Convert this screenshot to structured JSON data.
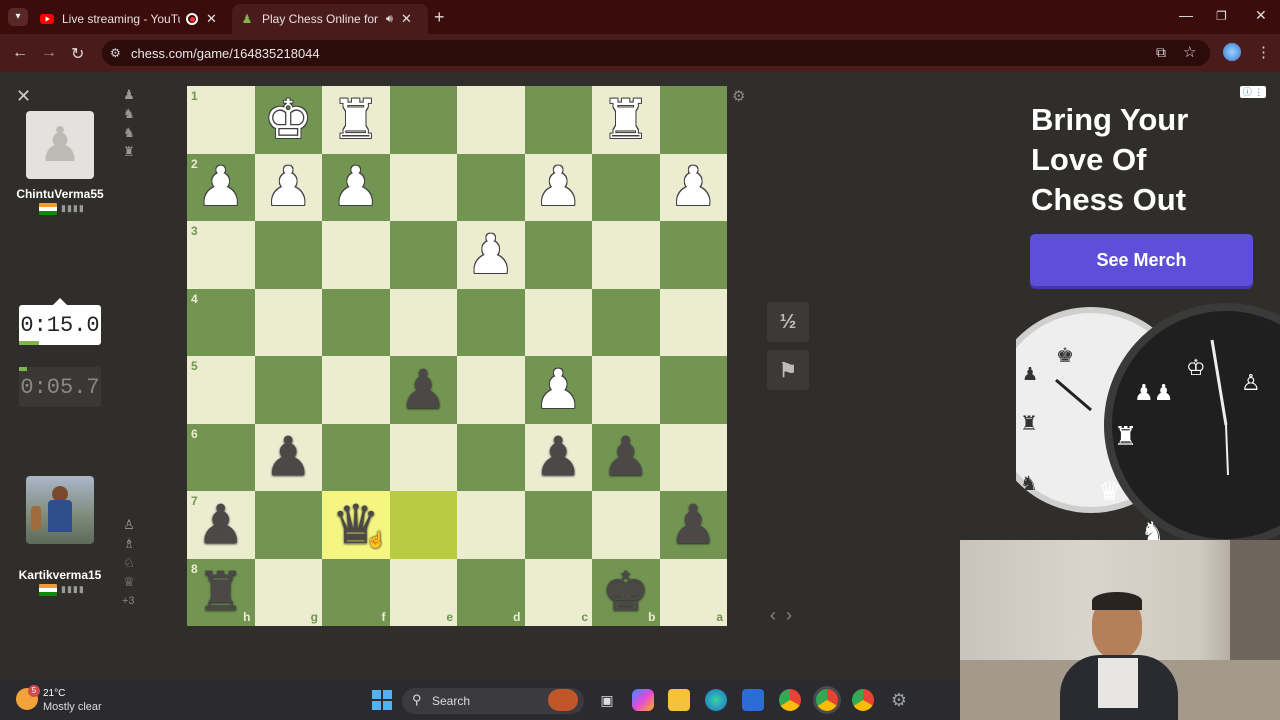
{
  "browser": {
    "tabs": [
      {
        "title": "Live streaming - YouTube Stu",
        "icon": "youtube-icon",
        "color": "#ff0000"
      },
      {
        "title": "Play Chess Online for FREE",
        "icon": "chess-pawn-icon",
        "color": "#81b64c"
      }
    ],
    "url": "chess.com/game/164835218044"
  },
  "players": {
    "top": {
      "name": "ChintuVerma55",
      "clock": "0:15.0",
      "clock_active": true
    },
    "bottom": {
      "name": "Kartikverma15",
      "clock": "0:05.7",
      "clock_active": false,
      "material": "+3"
    }
  },
  "board": {
    "orientation": "black",
    "ranks": [
      "1",
      "2",
      "3",
      "4",
      "5",
      "6",
      "7",
      "8"
    ],
    "files": [
      "h",
      "g",
      "f",
      "e",
      "d",
      "c",
      "b",
      "a"
    ],
    "rows": [
      [
        "",
        "wK",
        "wR",
        "",
        "",
        "",
        "wR",
        ""
      ],
      [
        "wP",
        "wP",
        "wP",
        "",
        "",
        "wP",
        "",
        "wP"
      ],
      [
        "",
        "",
        "",
        "",
        "wP",
        "",
        "",
        ""
      ],
      [
        "",
        "",
        "",
        "",
        "",
        "",
        "",
        ""
      ],
      [
        "",
        "",
        "",
        "bP",
        "",
        "wP",
        "",
        ""
      ],
      [
        "",
        "bP",
        "",
        "",
        "",
        "bP",
        "bP",
        ""
      ],
      [
        "bP",
        "",
        "bQ",
        "",
        "",
        "",
        "",
        "bP"
      ],
      [
        "bR",
        "",
        "",
        "",
        "",
        "",
        "bK",
        ""
      ]
    ],
    "highlights": [
      [
        6,
        2
      ],
      [
        6,
        3
      ]
    ]
  },
  "controls": {
    "draw_label": "½",
    "resign_icon": "flag-icon"
  },
  "ad": {
    "headline_lines": [
      "Bring Your",
      "Love Of",
      "Chess Out"
    ],
    "button": "See Merch"
  },
  "taskbar": {
    "temp": "21°C",
    "weather": "Mostly clear",
    "weather_badge": "5",
    "search": "Search"
  }
}
